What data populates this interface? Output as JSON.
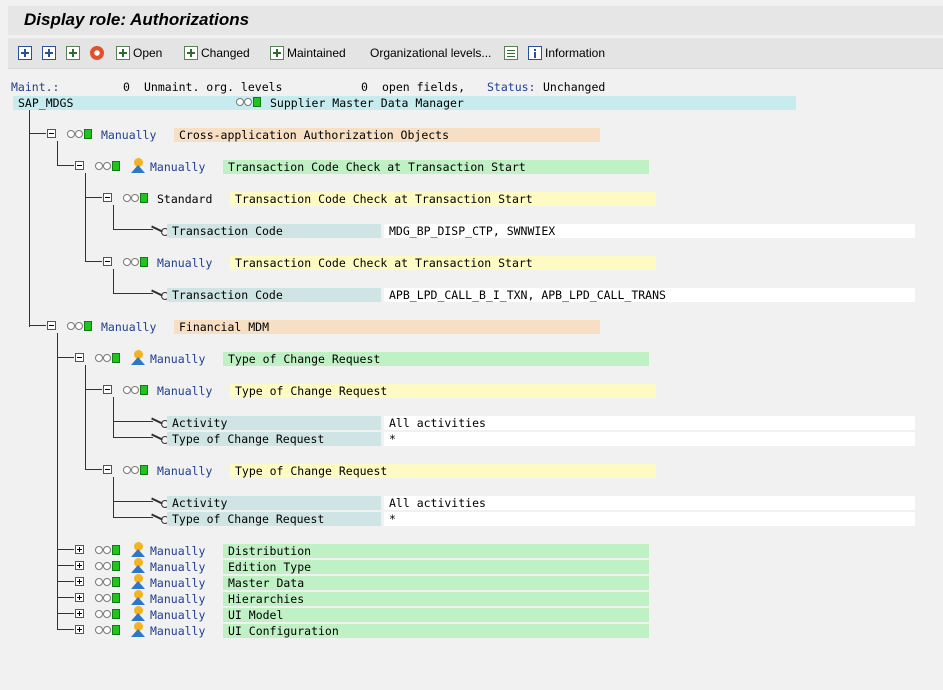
{
  "title": "Display role: Authorizations",
  "toolbar": {
    "open": "Open",
    "changed": "Changed",
    "maintained": "Maintained",
    "org_levels": "Organizational levels...",
    "information": "Information"
  },
  "status": {
    "maint_label": "Maint.:",
    "maint_count": "0",
    "unmaint_label": "Unmaint. org. levels",
    "open_count": "0",
    "open_label": "open fields,",
    "status_label": "Status:",
    "status_value": "Unchanged"
  },
  "role": {
    "name": "SAP_MDGS",
    "description": "Supplier Master Data Manager"
  },
  "tree": {
    "n1": {
      "mode": "Manually",
      "text": "Cross-application Authorization Objects"
    },
    "n1a": {
      "mode": "Manually",
      "text": "Transaction Code Check at Transaction Start"
    },
    "n1a1": {
      "mode": "Standard",
      "text": "Transaction Code Check at Transaction Start"
    },
    "n1a1f": {
      "field": "Transaction Code",
      "value": "MDG_BP_DISP_CTP, SWNWIEX"
    },
    "n1a2": {
      "mode": "Manually",
      "text": "Transaction Code Check at Transaction Start"
    },
    "n1a2f": {
      "field": "Transaction Code",
      "value": "APB_LPD_CALL_B_I_TXN, APB_LPD_CALL_TRANS"
    },
    "n2": {
      "mode": "Manually",
      "text": "Financial MDM"
    },
    "n2a": {
      "mode": "Manually",
      "text": "Type of Change Request"
    },
    "n2a1": {
      "mode": "Manually",
      "text": "Type of Change Request"
    },
    "n2a1f1": {
      "field": "Activity",
      "value": "All activities"
    },
    "n2a1f2": {
      "field": "Type of Change Request",
      "value": "*"
    },
    "n2a2": {
      "mode": "Manually",
      "text": "Type of Change Request"
    },
    "n2a2f1": {
      "field": "Activity",
      "value": "All activities"
    },
    "n2a2f2": {
      "field": "Type of Change Request",
      "value": "*"
    },
    "c1": {
      "mode": "Manually",
      "text": "Distribution"
    },
    "c2": {
      "mode": "Manually",
      "text": "Edition Type"
    },
    "c3": {
      "mode": "Manually",
      "text": "Master Data"
    },
    "c4": {
      "mode": "Manually",
      "text": "Hierarchies"
    },
    "c5": {
      "mode": "Manually",
      "text": "UI Model"
    },
    "c6": {
      "mode": "Manually",
      "text": "UI Configuration"
    }
  }
}
